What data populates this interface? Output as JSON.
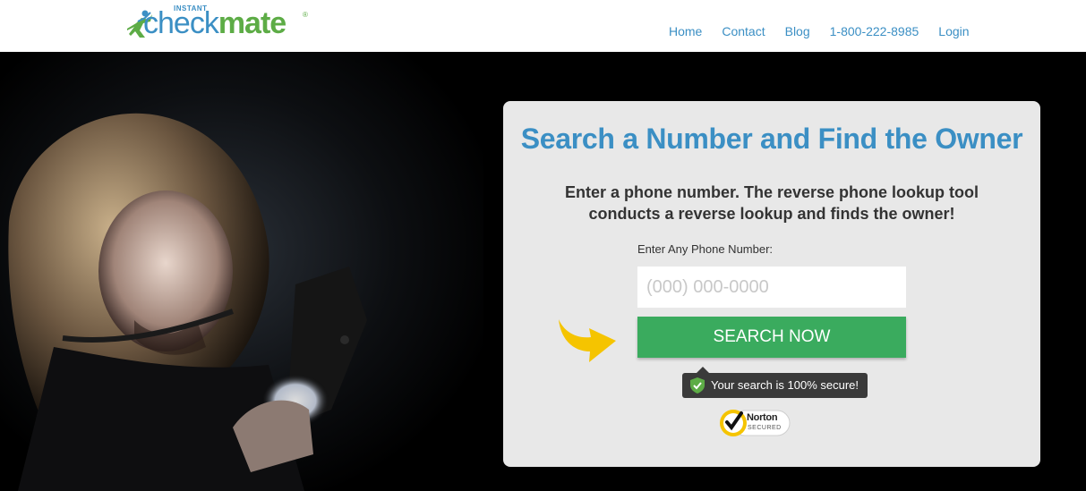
{
  "brand": {
    "instant": "INSTANT",
    "check": "check",
    "mate": "mate",
    "reg": "®",
    "blue": "#3b8fc4",
    "green": "#5dac46"
  },
  "nav": {
    "items": [
      {
        "label": "Home"
      },
      {
        "label": "Contact"
      },
      {
        "label": "Blog"
      },
      {
        "label": "1-800-222-8985"
      },
      {
        "label": "Login"
      }
    ]
  },
  "search": {
    "title": "Search a Number and Find the Owner",
    "description": "Enter a phone number. The reverse phone lookup tool conducts a reverse lookup and finds the owner!",
    "label": "Enter Any Phone Number:",
    "placeholder": "(000) 000-0000",
    "value": "",
    "button_label": "SEARCH NOW",
    "button_color": "#3aab5e",
    "secure_text": "Your search is 100% secure!",
    "arrow_color": "#f5c400"
  },
  "norton": {
    "name": "Norton",
    "sub": "SECURED"
  },
  "icons": {
    "logo_figure": "checkmate-figure-icon",
    "arrow": "curved-arrow-icon",
    "shield": "shield-check-icon",
    "norton_check": "norton-checkmark-icon"
  }
}
